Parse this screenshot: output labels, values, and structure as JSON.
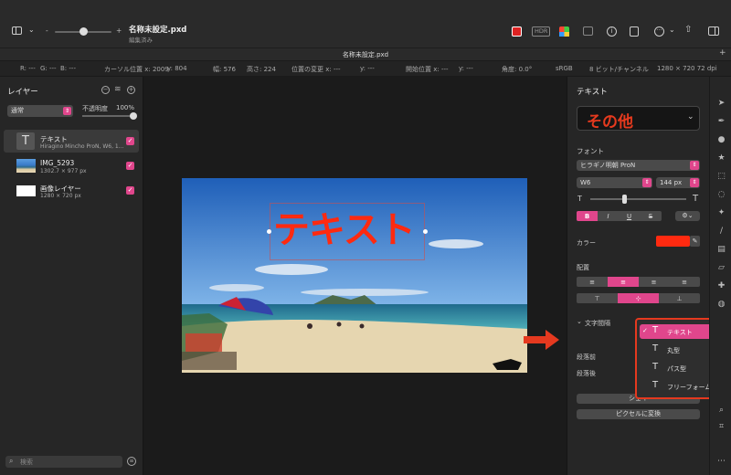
{
  "titlebar": {
    "doc_title": "名称未設定.pxd",
    "doc_subtitle": "編集済み",
    "zoom_minus": "-",
    "zoom_plus": "+",
    "hdr_label": "HDR",
    "tab_title": "名称未設定.pxd"
  },
  "infobar": {
    "r": "R: ---",
    "g": "G: ---",
    "b": "B: ---",
    "cursor_x": "カーソル位置 x: 2009",
    "cursor_y": "y: 804",
    "width": "幅: 576",
    "height": "高さ: 224",
    "change_x": "位置の変更 x: ---",
    "change_y": "y: ---",
    "start_x": "開始位置 x: ---",
    "start_y": "y: ---",
    "angle": "角度: 0.0°",
    "colorspace": "sRGB",
    "depth": "8 ビット/チャンネル",
    "size": "1280 × 720 72 dpi"
  },
  "layers": {
    "title": "レイヤー",
    "blend_mode": "通常",
    "opacity_label": "不透明度",
    "opacity_value": "100%",
    "opacity": 1.0,
    "items": [
      {
        "name": "テキスト",
        "detail": "Hiragino Mincho ProN, W6, 1..."
      },
      {
        "name": "IMG_5293",
        "detail": "1302.7 × 977 px"
      },
      {
        "name": "画像レイヤー",
        "detail": "1280 × 720 px"
      }
    ],
    "search_placeholder": "検索"
  },
  "canvas": {
    "text": "テキスト"
  },
  "inspector": {
    "title": "テキスト",
    "preset": "その他",
    "font_section": "フォント",
    "font_family": "ヒラギノ明朝 ProN",
    "font_weight": "W6",
    "font_size": "144 px",
    "size_slider": 0.35,
    "style_buttons": [
      "B",
      "I",
      "U",
      "S"
    ],
    "color_label": "カラー",
    "text_color": "#ff2a10",
    "align_section": "配置",
    "spacing_section": "文字間隔",
    "before_para": "段落前",
    "after_para": "段落後",
    "shape_button": "シェイ",
    "pixel_button": "ピクセルに変換"
  },
  "popup": {
    "items": [
      {
        "label": "テキスト",
        "selected": true
      },
      {
        "label": "丸型",
        "selected": false
      },
      {
        "label": "パス型",
        "selected": false
      },
      {
        "label": "フリーフォーム型",
        "selected": false
      }
    ]
  },
  "colors": {
    "accent": "#e0468c",
    "highlight": "#e5391f",
    "panel": "#262626"
  }
}
